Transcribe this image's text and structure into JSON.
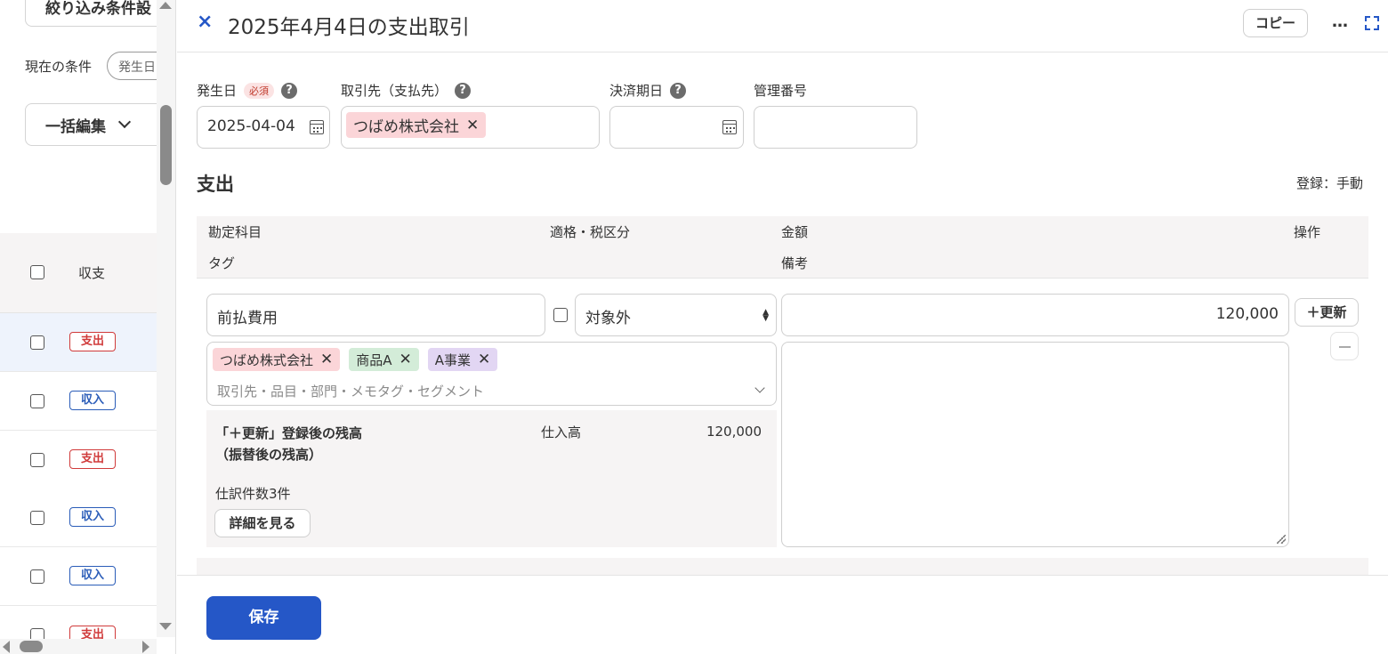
{
  "left": {
    "filter_button": "絞り込み条件設",
    "current_condition_label": "現在の条件",
    "current_condition_chip": "発生日",
    "bulk_edit_button": "一括編集",
    "list_header": "収支",
    "rows": [
      {
        "type": "支出",
        "kind": "out",
        "selected": true
      },
      {
        "type": "収入",
        "kind": "in"
      },
      {
        "type": "支出",
        "kind": "out"
      },
      {
        "type": "収入",
        "kind": "in"
      },
      {
        "type": "収入",
        "kind": "in"
      },
      {
        "type": "支出",
        "kind": "out"
      }
    ]
  },
  "panel": {
    "title": "2025年4月4日の支出取引",
    "copy_button": "コピー",
    "more_icon": "…",
    "close_icon": "×",
    "fields": {
      "date_label": "発生日",
      "required_badge": "必須",
      "date_value": "2025-04-04",
      "partner_label": "取引先（支払先）",
      "partner_tag": "つばめ株式会社",
      "due_label": "決済期日",
      "manage_label": "管理番号"
    },
    "section": {
      "title": "支出",
      "registration": "登録：手動"
    },
    "table_header": {
      "account": "勘定科目",
      "tax": "適格・税区分",
      "amount": "金額",
      "ops": "操作",
      "tag": "タグ",
      "memo": "備考"
    },
    "line": {
      "account": "前払費用",
      "tax": "対象外",
      "amount": "120,000",
      "update_button": "＋更新",
      "tags": [
        {
          "label": "つばめ株式会社",
          "color": "pink"
        },
        {
          "label": "商品A",
          "color": "green"
        },
        {
          "label": "A事業",
          "color": "purple"
        }
      ],
      "tag_placeholder": "取引先・品目・部門・メモタグ・セグメント"
    },
    "balance": {
      "title_line1": "「＋更新」登録後の残高",
      "title_line2": "（振替後の残高）",
      "account": "仕入高",
      "amount": "120,000",
      "count": "仕訳件数3件",
      "detail_button": "詳細を見る"
    },
    "save_button": "保存"
  },
  "colors": {
    "accent": "#2557c7",
    "expense": "#d03a3a",
    "income": "#2a5cb8"
  }
}
